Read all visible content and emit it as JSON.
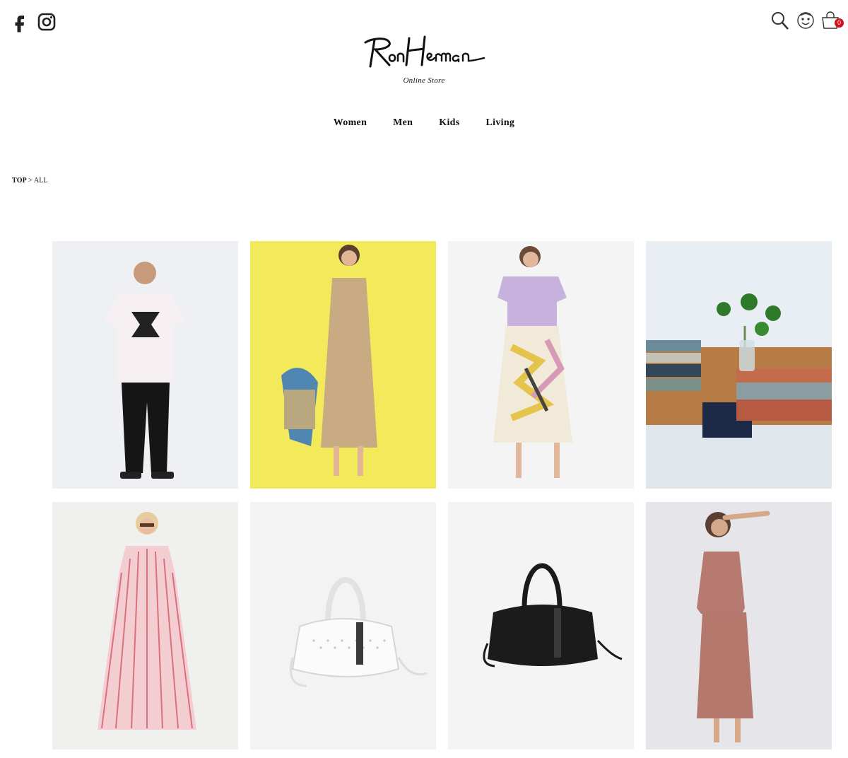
{
  "header": {
    "social": [
      {
        "name": "facebook-icon"
      },
      {
        "name": "instagram-icon"
      }
    ],
    "tools": [
      {
        "name": "search-icon"
      },
      {
        "name": "account-icon"
      },
      {
        "name": "cart-icon"
      }
    ],
    "cart_count": "0"
  },
  "logo": {
    "wordmark": "Ron Herman",
    "subtitle": "Online Store"
  },
  "nav": {
    "items": [
      {
        "label": "Women"
      },
      {
        "label": "Men"
      },
      {
        "label": "Kids"
      },
      {
        "label": "Living"
      }
    ]
  },
  "breadcrumb": {
    "top": "TOP",
    "separator": ">",
    "current": "ALL"
  },
  "products": [
    {
      "bg": "#eef0f3"
    },
    {
      "bg": "#f2ea5a"
    },
    {
      "bg": "#f5f4f4"
    },
    {
      "bg": "#e8eef3"
    },
    {
      "bg": "#f0f0ef"
    },
    {
      "bg": "#f3f3f3"
    },
    {
      "bg": "#f4f4f4"
    },
    {
      "bg": "#e6e6ea"
    }
  ],
  "colors": {
    "cart_badge": "#d0111b",
    "text": "#111111"
  }
}
